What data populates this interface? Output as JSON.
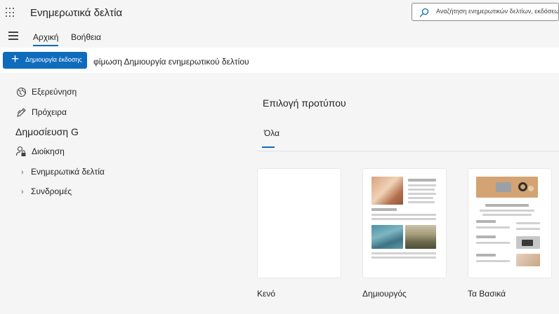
{
  "app": {
    "title": "Ενημερωτικά δελτία",
    "search_placeholder": "Αναζήτηση ενημερωτικών δελτίων, εκδόσεων, γ"
  },
  "nav": {
    "tabs": [
      {
        "label": "Αρχική",
        "active": true
      },
      {
        "label": "Βοήθεια",
        "active": false
      }
    ]
  },
  "commandbar": {
    "create_label": "Δημιουργία έκδοσης",
    "preview_text": "φίμωση Δημιουργία ενημερωτικού δελτίου"
  },
  "sidebar": {
    "explore": "Εξερεύνηση",
    "drafts": "Πρόχειρα",
    "publish_heading": "Δημοσίευση G",
    "admin": "Διοίκηση",
    "newsletters": "Ενημερωτικά δελτία",
    "subscriptions": "Συνδρομές"
  },
  "main": {
    "title": "Επιλογή προτύπου",
    "filter_tab": "Όλα",
    "templates": [
      {
        "name": "Κενό"
      },
      {
        "name": "Δημιουργός"
      },
      {
        "name": "Τα Βασικά"
      }
    ]
  },
  "colors": {
    "accent": "#0f6cbd",
    "background": "#f5f5f5"
  }
}
